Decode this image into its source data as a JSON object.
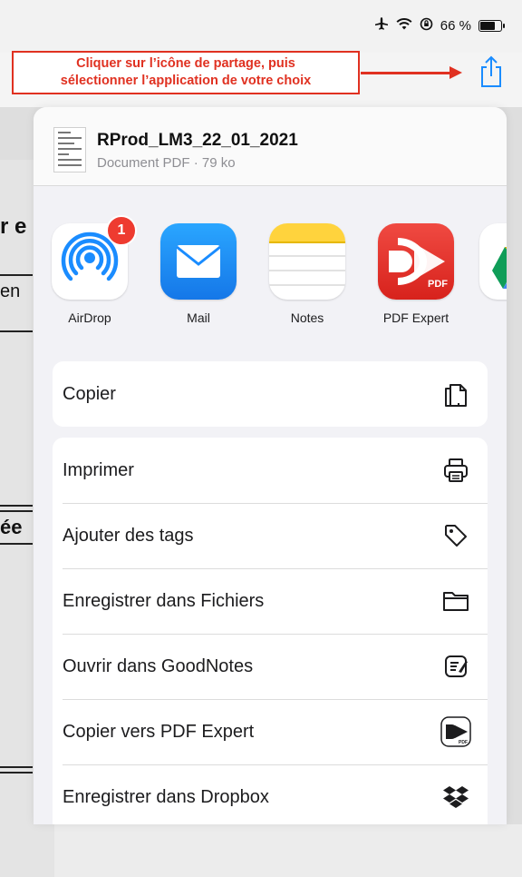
{
  "status_bar": {
    "battery_text": "66 %"
  },
  "annotation": {
    "line1": "Cliquer sur l’icône de partage, puis",
    "line2": "sélectionner l’application de votre choix"
  },
  "background_doc": {
    "fragment1": "r e",
    "fragment2": "en",
    "fragment3": "ée"
  },
  "share_sheet": {
    "document": {
      "title": "RProd_LM3_22_01_2021",
      "subtitle": "Document PDF · 79 ko"
    },
    "apps": [
      {
        "label": "AirDrop",
        "icon": "airdrop-icon",
        "badge": "1"
      },
      {
        "label": "Mail",
        "icon": "mail-icon"
      },
      {
        "label": "Notes",
        "icon": "notes-icon"
      },
      {
        "label": "PDF Expert",
        "icon": "pdf-expert-icon"
      }
    ],
    "copy_group": [
      {
        "label": "Copier",
        "icon": "copy-icon"
      }
    ],
    "actions": [
      {
        "label": "Imprimer",
        "icon": "printer-icon"
      },
      {
        "label": "Ajouter des tags",
        "icon": "tag-icon"
      },
      {
        "label": "Enregistrer dans Fichiers",
        "icon": "folder-icon"
      },
      {
        "label": "Ouvrir dans GoodNotes",
        "icon": "goodnotes-icon"
      },
      {
        "label": "Copier vers PDF Expert",
        "icon": "pdf-expert-small-icon"
      },
      {
        "label": "Enregistrer dans Dropbox",
        "icon": "dropbox-icon"
      }
    ]
  },
  "colors": {
    "annotation_red": "#e03121",
    "ios_blue": "#1a8cff",
    "mail_blue": "#1e8ff5",
    "pdf_red": "#e8332c",
    "badge_red": "#ee3b30"
  }
}
